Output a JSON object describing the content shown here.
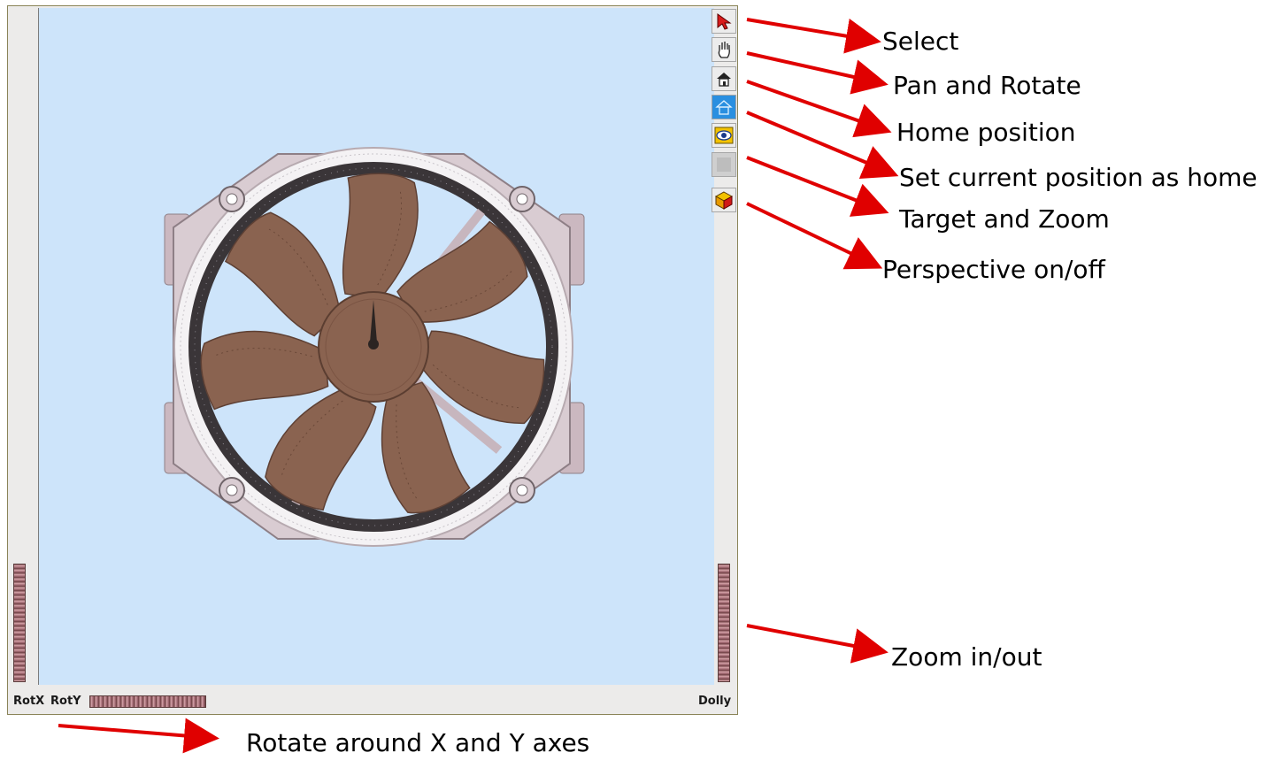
{
  "colors": {
    "viewport_bg": "#cde4fa",
    "blade": "#8a6350",
    "frame": "#cbb8c0",
    "ring": "#3a3538",
    "arrow": "#e00000"
  },
  "toolbar": {
    "buttons": [
      {
        "id": "select",
        "icon": "arrow-cursor-icon"
      },
      {
        "id": "pan-rotate",
        "icon": "hand-icon"
      },
      {
        "id": "home",
        "icon": "home-icon"
      },
      {
        "id": "set-home",
        "icon": "set-home-icon"
      },
      {
        "id": "target-zoom",
        "icon": "eye-target-icon"
      },
      {
        "id": "blank",
        "icon": "disabled-icon"
      },
      {
        "id": "perspective",
        "icon": "cube-icon"
      }
    ]
  },
  "wheels": {
    "rotx_label": "RotX",
    "roty_label": "RotY",
    "dolly_label": "Dolly"
  },
  "callouts": {
    "select": "Select",
    "pan_rotate": "Pan and Rotate",
    "home": "Home position",
    "set_home": "Set current position as home",
    "target_zoom": "Target and Zoom",
    "perspective": "Perspective on/off",
    "zoom": "Zoom in/out",
    "rotate_xy": "Rotate around X and Y axes"
  }
}
